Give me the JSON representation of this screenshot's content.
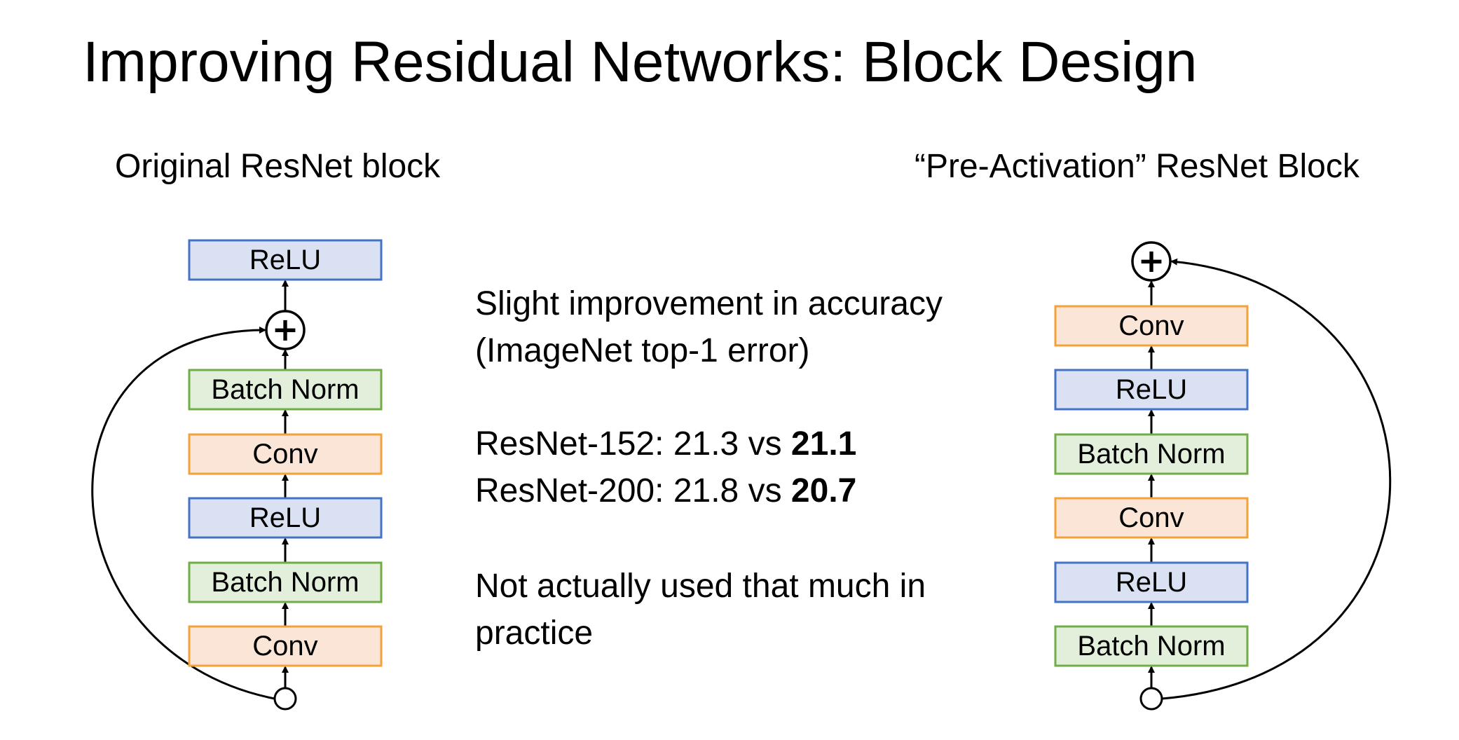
{
  "title": "Improving Residual Networks: Block Design",
  "left": {
    "heading": "Original ResNet block",
    "blocks_top_to_bottom": [
      {
        "label": "ReLU",
        "kind": "relu"
      },
      {
        "label": "Batch Norm",
        "kind": "bn"
      },
      {
        "label": "Conv",
        "kind": "conv"
      },
      {
        "label": "ReLU",
        "kind": "relu"
      },
      {
        "label": "Batch Norm",
        "kind": "bn"
      },
      {
        "label": "Conv",
        "kind": "conv"
      }
    ],
    "add_symbol": "+"
  },
  "right": {
    "heading": "“Pre-Activation” ResNet Block",
    "blocks_top_to_bottom": [
      {
        "label": "Conv",
        "kind": "conv"
      },
      {
        "label": "ReLU",
        "kind": "relu"
      },
      {
        "label": "Batch Norm",
        "kind": "bn"
      },
      {
        "label": "Conv",
        "kind": "conv"
      },
      {
        "label": "ReLU",
        "kind": "relu"
      },
      {
        "label": "Batch Norm",
        "kind": "bn"
      }
    ],
    "add_symbol": "+"
  },
  "notes": {
    "accuracy_line1": "Slight improvement in accuracy",
    "accuracy_line2": "(ImageNet top-1 error)",
    "results": [
      {
        "model": "ResNet-152:",
        "original": "21.3",
        "vs": "vs",
        "preact": "21.1"
      },
      {
        "model": "ResNet-200:",
        "original": "21.8",
        "vs": "vs",
        "preact": "20.7"
      }
    ],
    "usage_line1": "Not actually used that much in",
    "usage_line2": "practice"
  },
  "colors": {
    "relu": {
      "fill": "#dae1f3",
      "stroke": "#4472c4"
    },
    "bn": {
      "fill": "#e2efda",
      "stroke": "#70ad47"
    },
    "conv": {
      "fill": "#fbe5d6",
      "stroke": "#f4a13a"
    },
    "line": "#000000"
  }
}
